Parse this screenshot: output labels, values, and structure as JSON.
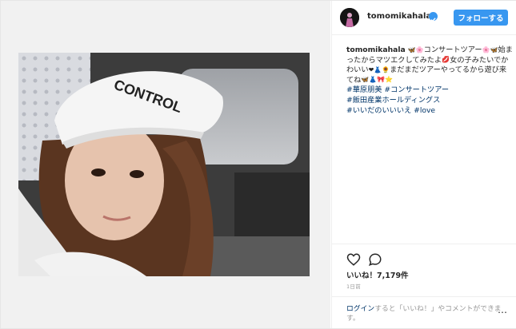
{
  "post": {
    "username": "tomomikahala",
    "follow_label": "フォローする",
    "caption": {
      "seg1": "コンサートツアー",
      "seg2": "始まったからマツエクしてみたよ",
      "seg3": "女の子みたいでかわいい",
      "seg4": "まだまだツアーやってるから遊び来てね",
      "hashtags": [
        "#華原朋美",
        "#コンサートツアー",
        "#飯田産業ホールディングス",
        "#いいだのいいいえ",
        "#love"
      ]
    },
    "photo": {
      "cap_text": "CONTROL"
    },
    "likes_text": "いいね！7,179件",
    "timestamp": "1日前",
    "login": {
      "link_text": "ログイン",
      "rest_text": "すると「いいね！」やコメントができます。"
    }
  },
  "icons": [
    "verified-badge-icon",
    "heart-icon",
    "comment-icon",
    "more-options-icon"
  ],
  "colors": {
    "accent": "#3897f0",
    "hashtag": "#003569",
    "muted": "#999999",
    "text": "#262626"
  }
}
